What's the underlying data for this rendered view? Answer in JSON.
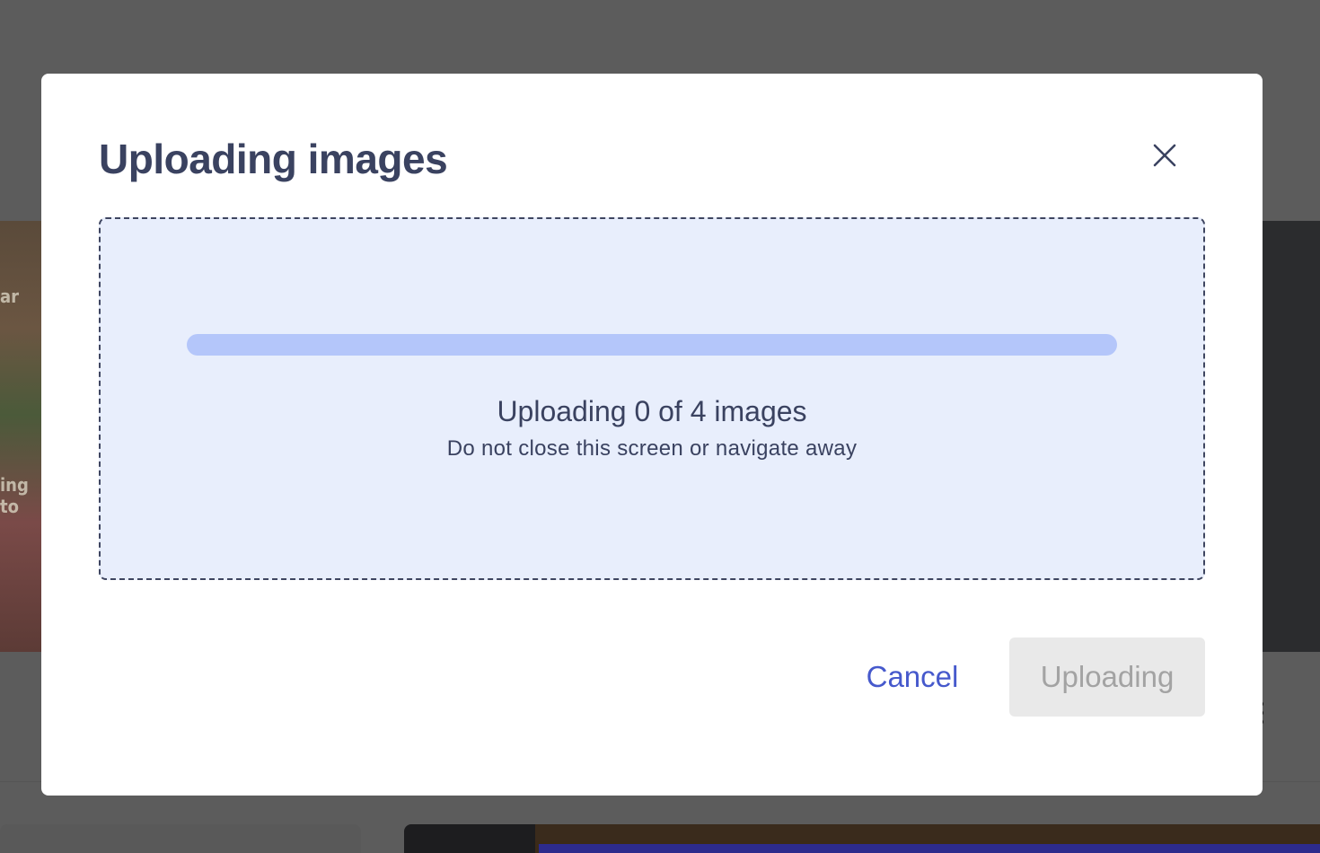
{
  "modal": {
    "title": "Uploading images",
    "close_icon": "close-icon"
  },
  "upload": {
    "progress": 0,
    "status_text": "Uploading 0 of 4 images",
    "warning_text": "Do not close this screen or navigate away",
    "uploaded_count": 0,
    "total_count": 4
  },
  "actions": {
    "cancel_label": "Cancel",
    "uploading_label": "Uploading"
  },
  "colors": {
    "title": "#3a4260",
    "dropzone_bg": "#e8eefc",
    "progress_track": "#b4c6fa",
    "link_blue": "#4659cc",
    "disabled_bg": "#e9e9e9",
    "disabled_text": "#a3a3a3",
    "backdrop": "#5c5c5c"
  },
  "background": {
    "banner_fragment_top": "ar",
    "banner_fragment_mid": "ing to"
  }
}
